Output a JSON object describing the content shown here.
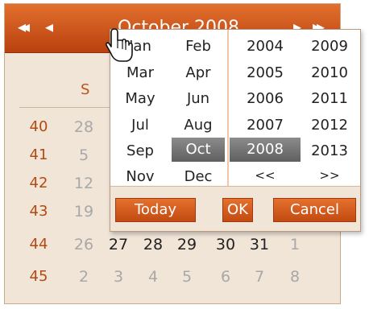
{
  "header": {
    "prev_year": "«",
    "prev_month": "◂",
    "title": "October 2008",
    "next_month": "▸",
    "next_year": "»"
  },
  "weekday_header": [
    "S"
  ],
  "weeks": [
    {
      "num": "40",
      "days": [
        "28"
      ]
    },
    {
      "num": "41",
      "days": [
        "5"
      ]
    },
    {
      "num": "42",
      "days": [
        "12"
      ]
    },
    {
      "num": "43",
      "days": [
        "19"
      ]
    },
    {
      "num": "44",
      "days": [
        "26",
        "27",
        "28",
        "29",
        "30",
        "31",
        "1"
      ]
    },
    {
      "num": "45",
      "days": [
        "2",
        "3",
        "4",
        "5",
        "6",
        "7",
        "8"
      ]
    }
  ],
  "picker": {
    "months": [
      "Jan",
      "Feb",
      "Mar",
      "Apr",
      "May",
      "Jun",
      "Jul",
      "Aug",
      "Sep",
      "Oct",
      "Nov",
      "Dec"
    ],
    "selected_month": "Oct",
    "years": [
      "2004",
      "2009",
      "2005",
      "2010",
      "2006",
      "2011",
      "2007",
      "2012",
      "2008",
      "2013"
    ],
    "selected_year": "2008",
    "prev_years": "<<",
    "next_years": ">>",
    "today_label": "Today",
    "ok_label": "OK",
    "cancel_label": "Cancel"
  },
  "colors": {
    "header": "#d0581e",
    "accent": "#c1511a",
    "background": "#f1e5d8",
    "selected": "#707070"
  }
}
